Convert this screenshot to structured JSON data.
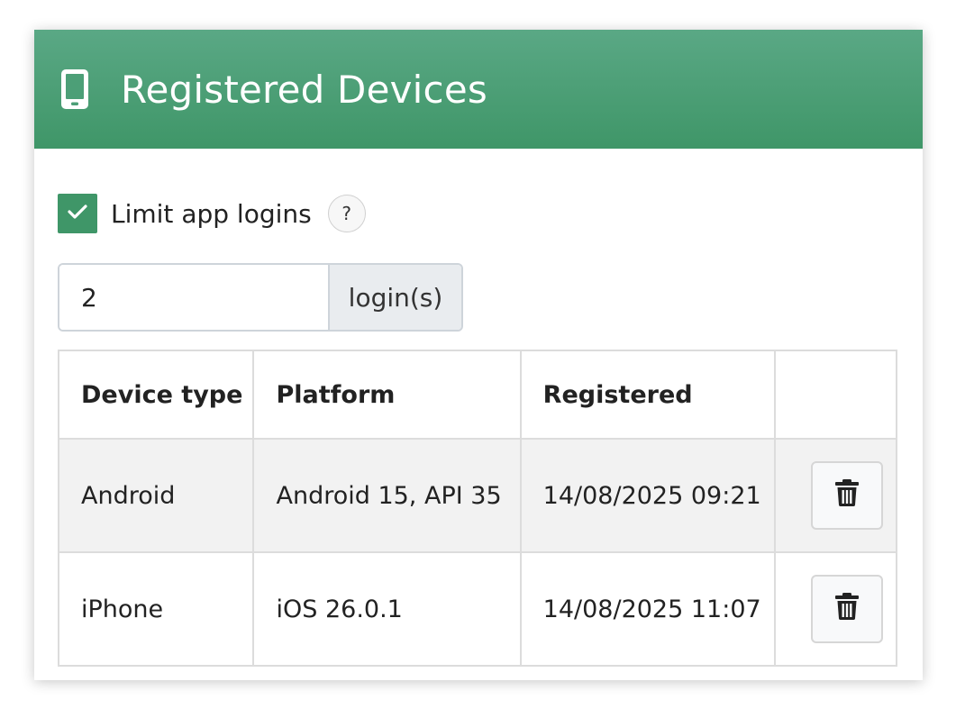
{
  "panel": {
    "title": "Registered Devices",
    "header_color": "#4a9e74",
    "icon": "mobile-device-icon"
  },
  "limit": {
    "checkbox_checked": true,
    "label": "Limit app logins",
    "help_label": "?",
    "login_value": "2",
    "login_addon": "login(s)"
  },
  "table": {
    "headers": [
      "Device type",
      "Platform",
      "Registered",
      ""
    ],
    "rows": [
      {
        "type": "Android",
        "platform": "Android 15, API 35",
        "registered": "14/08/2025 09:21",
        "action_icon": "trash-icon"
      },
      {
        "type": "iPhone",
        "platform": "iOS 26.0.1",
        "registered": "14/08/2025 11:07",
        "action_icon": "trash-icon"
      }
    ]
  }
}
